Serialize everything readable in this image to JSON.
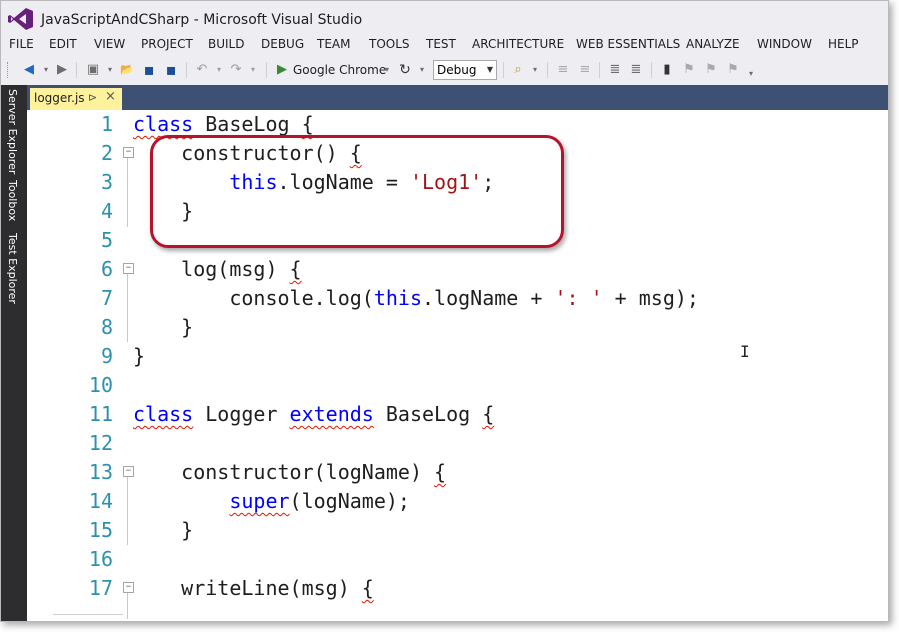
{
  "window": {
    "title": "JavaScriptAndCSharp - Microsoft Visual Studio"
  },
  "menu": [
    "FILE",
    "EDIT",
    "VIEW",
    "PROJECT",
    "BUILD",
    "DEBUG",
    "TEAM",
    "TOOLS",
    "TEST",
    "ARCHITECTURE",
    "WEB ESSENTIALS",
    "ANALYZE",
    "WINDOW",
    "HELP"
  ],
  "toolbar": {
    "browser_label": "Google Chrome",
    "config_value": "Debug",
    "icons": {
      "back": "◀",
      "forward": "▶",
      "new": "▣",
      "open": "📂",
      "save": "▪",
      "save_all": "▪",
      "undo": "↶",
      "redo": "↷",
      "play": "▶",
      "refresh": "↻",
      "find": "⌕",
      "indent": "≡",
      "outdent": "≡",
      "comment": "≣",
      "uncomment": "≣",
      "bookmark": "▮",
      "prev_bm": "⚑",
      "next_bm": "⚑",
      "clear_bm": "⚑",
      "overflow": "▾"
    }
  },
  "side_tabs": [
    "Server Explorer",
    "Toolbox",
    "Test Explorer"
  ],
  "document_tab": {
    "name": "logger.js",
    "pin": "⊳",
    "close": "×"
  },
  "code_lines": [
    {
      "n": "1",
      "text": "class BaseLog {"
    },
    {
      "n": "2",
      "text": "    constructor() {"
    },
    {
      "n": "3",
      "text": "        this.logName = 'Log1';"
    },
    {
      "n": "4",
      "text": "    }"
    },
    {
      "n": "5",
      "text": ""
    },
    {
      "n": "6",
      "text": "    log(msg) {"
    },
    {
      "n": "7",
      "text": "        console.log(this.logName + ': ' + msg);"
    },
    {
      "n": "8",
      "text": "    }"
    },
    {
      "n": "9",
      "text": "}"
    },
    {
      "n": "10",
      "text": ""
    },
    {
      "n": "11",
      "text": "class Logger extends BaseLog {"
    },
    {
      "n": "12",
      "text": ""
    },
    {
      "n": "13",
      "text": "    constructor(logName) {"
    },
    {
      "n": "14",
      "text": "        super(logName);"
    },
    {
      "n": "15",
      "text": "    }"
    },
    {
      "n": "16",
      "text": ""
    },
    {
      "n": "17",
      "text": "    writeLine(msg) {"
    }
  ],
  "colors": {
    "keyword": "#0000ff",
    "string": "#a31515",
    "line_number": "#2b91af",
    "highlight": "#b5152b",
    "tab_active": "#fff29d",
    "tabstrip": "#3e5074"
  }
}
